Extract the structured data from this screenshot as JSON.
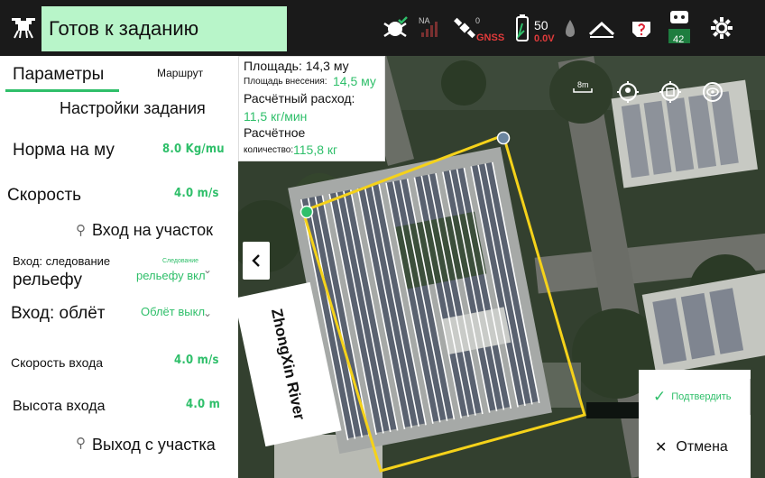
{
  "header": {
    "status_text": "Готов к заданию",
    "icons": [
      {
        "name": "drone-logo-icon"
      },
      {
        "name": "drone-status-icon",
        "color": "#2fbf6a"
      },
      {
        "name": "rc-signal-icon",
        "label": "NA"
      },
      {
        "name": "gnss-satellite-icon",
        "count": "0",
        "label": "GNSS"
      },
      {
        "name": "battery-icon",
        "percent": "50",
        "voltage": "0.0V"
      },
      {
        "name": "spray-level-icon"
      },
      {
        "name": "terrain-radar-icon"
      },
      {
        "name": "obstacle-warning-icon",
        "label": "?"
      },
      {
        "name": "controller-battery-icon",
        "value": "42"
      },
      {
        "name": "settings-gear-icon"
      }
    ]
  },
  "panel": {
    "tab_params": "Параметры",
    "tab_route": "Маршрут",
    "section_title": "Настройки задания",
    "rate_label": "Норма на му",
    "rate_value": "8.0 Kg/mu",
    "speed_label": "Скорость",
    "speed_value": "4.0 m/s",
    "entry_header": "Вход на участок",
    "entry_follow_label_line1": "Вход: следование",
    "entry_follow_label_line2": "рельефу",
    "entry_follow_value_line1": "Следование",
    "entry_follow_value_line2": "рельефу вкл",
    "entry_avoid_label": "Вход: облёт",
    "entry_avoid_value": "Облёт выкл",
    "entry_speed_label": "Скорость входа",
    "entry_speed_value": "4.0 m/s",
    "entry_height_label": "Высота входа",
    "entry_height_value": "4.0 m",
    "exit_header": "Выход с участка"
  },
  "info": {
    "area_line": "Площадь: 14,3 му",
    "applied_label": "Площадь внесения:",
    "applied_value": "14,5 му",
    "calc_rate_label": "Расчётный расход:",
    "calc_rate_value": "11,5 кг/мин",
    "calc_qty_label1": "Расчётное",
    "calc_qty_label2": "количество:",
    "calc_qty_value": "115,8 кг"
  },
  "map": {
    "scale": "8m",
    "river": "ZhongXin River"
  },
  "actions": {
    "confirm": "Подтвердить",
    "cancel": "Отмена"
  },
  "colors": {
    "accent": "#2fbf6a",
    "field_border": "#f5d21a",
    "status_bg": "#b8f5c9"
  }
}
